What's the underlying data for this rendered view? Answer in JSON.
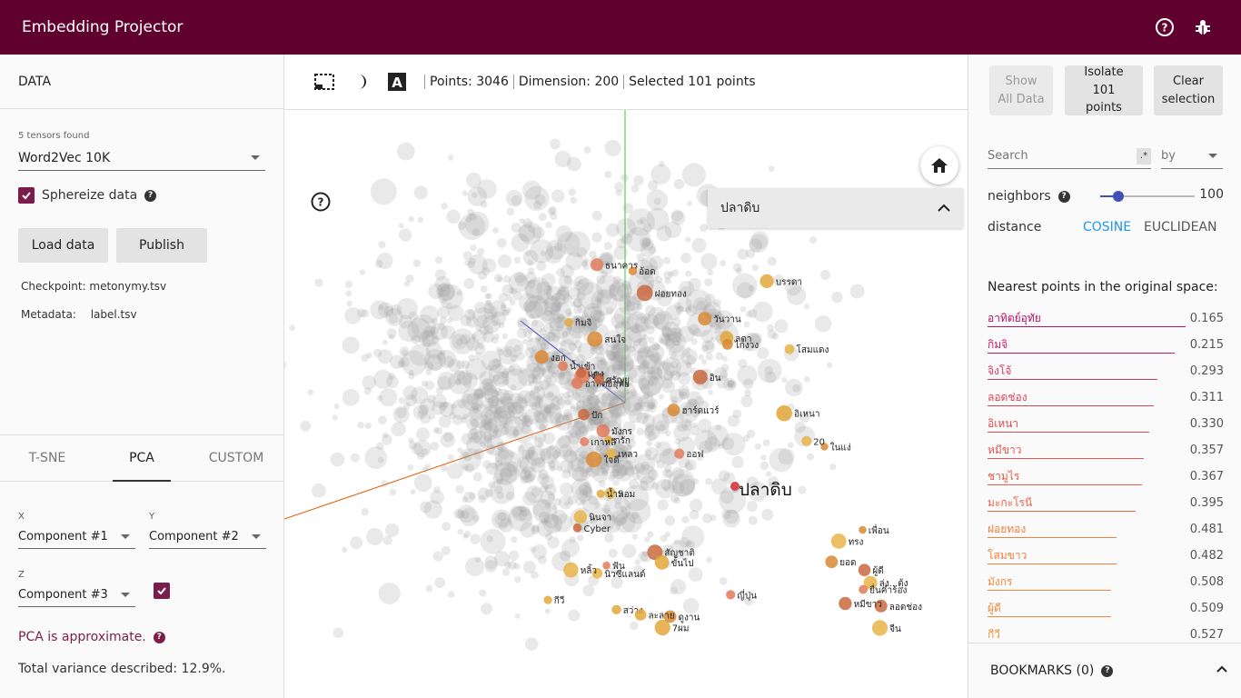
{
  "app": {
    "title": "Embedding Projector"
  },
  "top_icons": [
    "help-icon",
    "bug-icon"
  ],
  "left": {
    "section_title": "DATA",
    "tensors_found": "5 tensors found",
    "tensor_selected": "Word2Vec 10K",
    "sphereize_label": "Sphereize data",
    "sphereize_checked": true,
    "load_button": "Load data",
    "publish_button": "Publish",
    "checkpoint": "Checkpoint: metonymy.tsv",
    "metadata_label": "Metadata:",
    "metadata_value": "label.tsv",
    "tabs": [
      "T-SNE",
      "PCA",
      "CUSTOM"
    ],
    "active_tab": "PCA",
    "x_label": "X",
    "x_value": "Component #1",
    "y_label": "Y",
    "y_value": "Component #2",
    "z_label": "Z",
    "z_value": "Component #3",
    "z_checked": true,
    "pca_approx": "PCA is approximate.",
    "variance": "Total variance described: 12.9%."
  },
  "toolbar": {
    "points": "Points: 3046",
    "dimension": "Dimension: 200",
    "selected": "Selected 101 points"
  },
  "canvas": {
    "search_result": "ปลาดิบ",
    "focus_label": "ปลาดิบ",
    "labels": [
      "ลดา",
      "งอก",
      "เหลว",
      "ฝอยทอง",
      "มิซ",
      "สว่าง",
      "ไก่งวง",
      "นิวซีแลนด์",
      "ลอดช่อง",
      "มังกร",
      "อิเหนา",
      "ในแง่",
      "ลุ่ง...ตุ้ง",
      "หมีขาว",
      "ยื่นคำร้อง",
      "กีวี",
      "ดูงาน",
      "โสมแดง",
      "ผู้ดี",
      "อาทิตย์อุทัย",
      "ละลาย",
      "วันวาน",
      "นินจา",
      "สัญชาติ",
      "น้ำเข้า",
      "กรัก",
      "อ้อด",
      "จีน",
      "แดง",
      "ธนาคาร",
      "กิมจิ",
      "ใจดี",
      "S",
      "Cyber",
      "ญี่ปุ่น",
      "น้ำหอม",
      "ฮาร์ดแวร์",
      "หลิ้ว",
      "ศรัญยู",
      "ออฟ",
      "7ผม",
      "ยอด",
      "20",
      "อิน",
      "ฟัน",
      "บรรดา",
      "เพื่อน",
      "ทรง",
      "ปัก",
      "เกาหลี",
      "ขั้นไป",
      "สนใจ"
    ]
  },
  "right": {
    "show_all": "Show\nAll Data",
    "isolate": "Isolate\n101\npoints",
    "clear": "Clear\nselection",
    "search_placeholder": "Search",
    "regex": ".*",
    "by": "by",
    "neighbors_label": "neighbors",
    "neighbors_value": "100",
    "distance_label": "distance",
    "cosine": "COSINE",
    "euclidean": "EUCLIDEAN",
    "nearest_title": "Nearest points in the original space:",
    "nearest": [
      {
        "label": "อาทิตย์อุทัย",
        "value": "0.165",
        "color": "#b5116a"
      },
      {
        "label": "กิมจิ",
        "value": "0.215",
        "color": "#c81a64"
      },
      {
        "label": "จิงโจ้",
        "value": "0.293",
        "color": "#d9395a"
      },
      {
        "label": "ลอดช่อง",
        "value": "0.311",
        "color": "#df4356"
      },
      {
        "label": "อิเหนา",
        "value": "0.330",
        "color": "#e24d52"
      },
      {
        "label": "หมีขาว",
        "value": "0.357",
        "color": "#e7564e"
      },
      {
        "label": "ชามูไร",
        "value": "0.367",
        "color": "#e95b4c"
      },
      {
        "label": "มะกะโรนี",
        "value": "0.395",
        "color": "#ec6548"
      },
      {
        "label": "ฝอยทอง",
        "value": "0.481",
        "color": "#f08040"
      },
      {
        "label": "โสมขาว",
        "value": "0.482",
        "color": "#f08040"
      },
      {
        "label": "มังกร",
        "value": "0.508",
        "color": "#f2893c"
      },
      {
        "label": "ผู้ดี",
        "value": "0.509",
        "color": "#f2893c"
      },
      {
        "label": "กีวี",
        "value": "0.527",
        "color": "#f39039"
      }
    ],
    "bookmarks": "BOOKMARKS (0)"
  },
  "colors": {
    "brand": "#60002e",
    "accent": "#7b1d4a",
    "link": "#2196f3"
  }
}
